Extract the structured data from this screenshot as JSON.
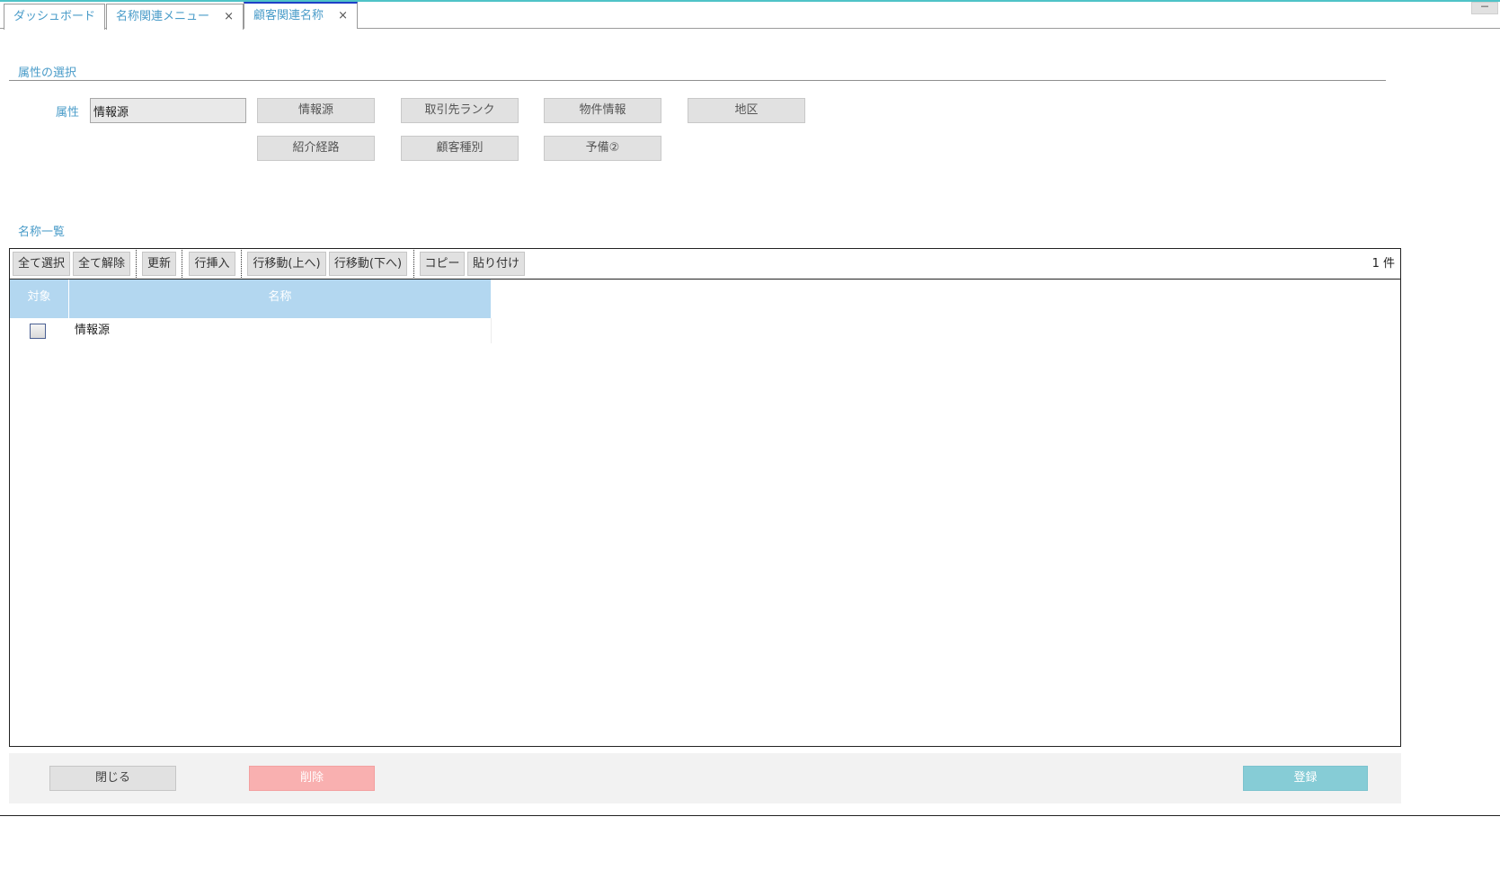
{
  "tabs": [
    {
      "label": "ダッシュボード",
      "closable": false
    },
    {
      "label": "名称関連メニュー",
      "closable": true
    },
    {
      "label": "顧客関連名称",
      "closable": true,
      "active": true
    }
  ],
  "tab_close_glyph": "×",
  "minimize_glyph": "－",
  "attribute_section": {
    "title": "属性の選択",
    "field_label": "属性",
    "field_value": "情報源",
    "buttons_row1": [
      "情報源",
      "取引先ランク",
      "物件情報",
      "地区"
    ],
    "buttons_row2": [
      "紹介経路",
      "顧客種別",
      "予備②"
    ]
  },
  "list_section": {
    "title": "名称一覧",
    "toolbar": {
      "select_all": "全て選択",
      "deselect_all": "全て解除",
      "refresh": "更新",
      "insert_row": "行挿入",
      "move_up": "行移動(上へ)",
      "move_down": "行移動(下へ)",
      "copy": "コピー",
      "paste": "貼り付け"
    },
    "count_label": "1 件",
    "columns": [
      "対象",
      "名称"
    ],
    "rows": [
      {
        "checked": false,
        "name": "情報源"
      }
    ]
  },
  "footer": {
    "close": "閉じる",
    "delete": "削除",
    "register": "登録"
  },
  "colors": {
    "accent": "#4a9cc9",
    "header_bg": "#b3d7f0",
    "delete_bg": "#f9b0b0",
    "register_bg": "#86ccd6",
    "active_tab_border": "#1f3fc7"
  }
}
